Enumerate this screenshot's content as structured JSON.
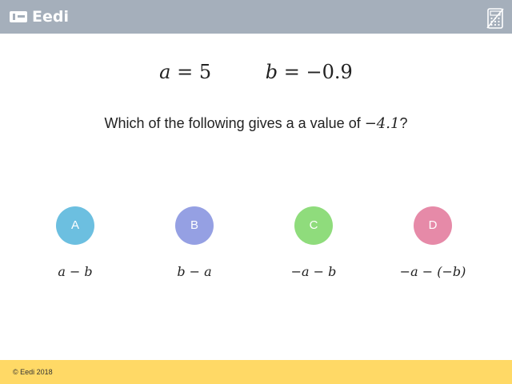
{
  "header": {
    "logo_text": "Eedi",
    "background_color": "#a5afbb",
    "calculator_icon": "calculator-disabled-icon"
  },
  "expressions": {
    "a_var": "a",
    "a_equals": "=",
    "a_value": "5",
    "b_var": "b",
    "b_equals": "=",
    "b_value": "−0.9"
  },
  "question": {
    "text_before": "Which of the following gives a a value of ",
    "value": "−4.1",
    "text_after": "?"
  },
  "options": [
    {
      "letter": "A",
      "answer": "a − b",
      "color": "#6cbfe0"
    },
    {
      "letter": "B",
      "answer": "b − a",
      "color": "#95a0e3"
    },
    {
      "letter": "C",
      "answer": "−a − b",
      "color": "#8fdc7c"
    },
    {
      "letter": "D",
      "answer": "−a − (−b)",
      "color": "#e68aa8"
    }
  ],
  "footer": {
    "copyright": "© Eedi 2018",
    "background_color": "#ffd966"
  }
}
